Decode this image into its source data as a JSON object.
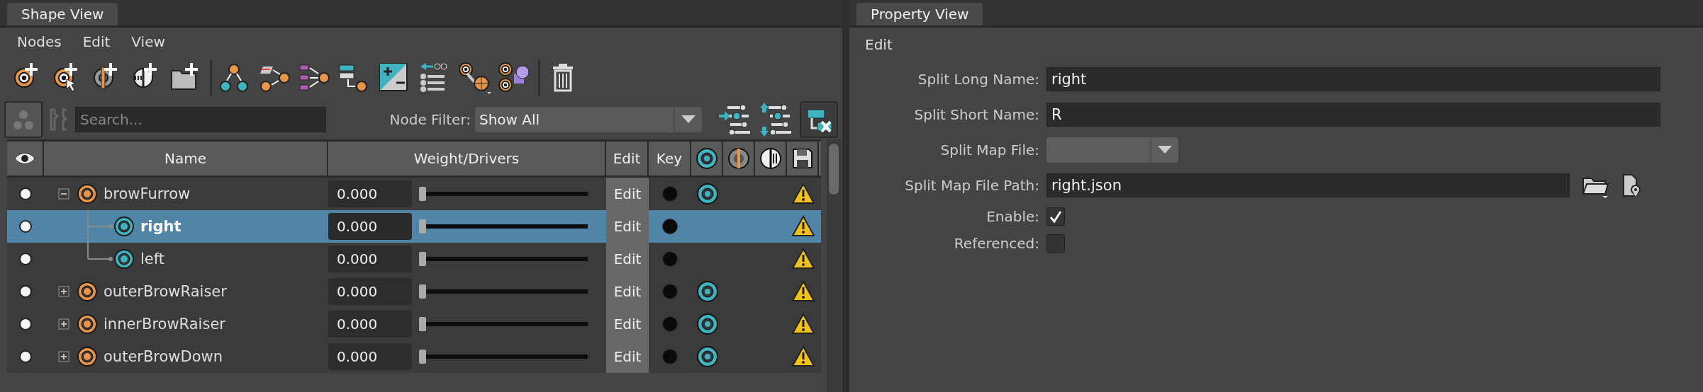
{
  "shape_view": {
    "tab": "Shape View",
    "menu": [
      "Nodes",
      "Edit",
      "View"
    ],
    "search": {
      "placeholder": "Search..."
    },
    "node_filter": {
      "label": "Node Filter:",
      "value": "Show All"
    },
    "table": {
      "columns": [
        "Name",
        "Weight/Drivers",
        "Edit",
        "Key"
      ],
      "rows": [
        {
          "name": "browFurrow",
          "kind": "shape",
          "visible": true,
          "expanded": true,
          "selected": false,
          "weight": "0.000",
          "level": 0,
          "edit": "Edit",
          "keyed": true,
          "target": true,
          "warning": true,
          "children": [
            {
              "name": "right",
              "kind": "split",
              "visible": true,
              "selected": true,
              "weight": "0.000",
              "level": 0,
              "edit": "Edit",
              "keyed": true,
              "target": false,
              "warning": true
            },
            {
              "name": "left",
              "kind": "split",
              "visible": true,
              "selected": false,
              "weight": "0.000",
              "level": 0,
              "edit": "Edit",
              "keyed": true,
              "target": false,
              "warning": true
            }
          ]
        },
        {
          "name": "outerBrowRaiser",
          "kind": "shape",
          "visible": true,
          "expanded": false,
          "selected": false,
          "weight": "0.000",
          "level": 0,
          "edit": "Edit",
          "keyed": true,
          "target": true,
          "warning": true
        },
        {
          "name": "innerBrowRaiser",
          "kind": "shape",
          "visible": true,
          "expanded": false,
          "selected": false,
          "weight": "0.000",
          "level": 0,
          "edit": "Edit",
          "keyed": true,
          "target": true,
          "warning": true
        },
        {
          "name": "outerBrowDown",
          "kind": "shape",
          "visible": true,
          "expanded": false,
          "selected": false,
          "weight": "0.000",
          "level": 0,
          "edit": "Edit",
          "keyed": true,
          "target": true,
          "warning": true
        }
      ]
    }
  },
  "property_view": {
    "tab": "Property View",
    "section": "Edit",
    "fields": [
      {
        "kind": "text",
        "label": "Split Long Name:",
        "value": "right"
      },
      {
        "kind": "text",
        "label": "Split Short Name:",
        "value": "R"
      },
      {
        "kind": "dropdown",
        "label": "Split Map File:",
        "disabled": true
      },
      {
        "kind": "path",
        "label": "Split Map File Path:",
        "value": "right.json"
      },
      {
        "kind": "checkbox",
        "label": "Enable:",
        "checked": true
      },
      {
        "kind": "checkbox",
        "label": "Referenced:",
        "checked": false
      }
    ]
  }
}
